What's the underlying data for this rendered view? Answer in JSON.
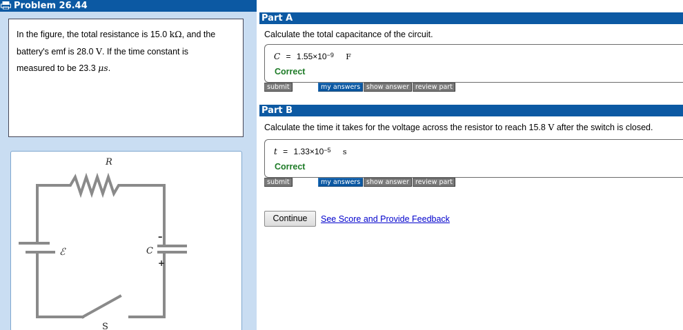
{
  "problem": {
    "title": "Problem 26.44",
    "icon": "print-icon",
    "text": {
      "line1_a": "In the figure, the total resistance is 15.0 ",
      "line1_unit": "kΩ",
      "line1_b": ", and the",
      "line2_a": "battery's emf is 28.0 ",
      "line2_unit": "V",
      "line2_b": ". If the time constant is",
      "line3_a": "measured to be 23.3 ",
      "line3_unit": "μs",
      "line3_b": "."
    }
  },
  "figure": {
    "labels": {
      "resistor": "R",
      "emf": "ℰ",
      "capacitor": "C",
      "switch": "S",
      "minus": "–",
      "plus": "+"
    },
    "wire_color": "#8a8a8a"
  },
  "parts": [
    {
      "header": "Part A",
      "question_a": "Calculate the total capacitance of the circuit.",
      "answer": {
        "variable": "C",
        "equals": "=",
        "mantissa": "1.55×10",
        "exponent": "−9",
        "unit": "F"
      },
      "status": "Correct"
    },
    {
      "header": "Part B",
      "question_a": "Calculate the time it takes for the voltage across the resistor to reach 15.8 ",
      "question_unit": "V",
      "question_b": " after the switch is closed.",
      "answer": {
        "variable": "t",
        "equals": "=",
        "mantissa": "1.33×10",
        "exponent": "−5",
        "unit": "s"
      },
      "status": "Correct"
    }
  ],
  "buttons": {
    "submit": "submit",
    "my_answers": "my answers",
    "show_answer": "show answer",
    "review_part": "review part"
  },
  "continue_label": "Continue",
  "feedback_link": "See Score and Provide Feedback",
  "colors": {
    "header_blue": "#0c59a3",
    "panel_blue": "#c9ddf2",
    "correct_green": "#1c7a25",
    "link_blue": "#0000cc"
  }
}
